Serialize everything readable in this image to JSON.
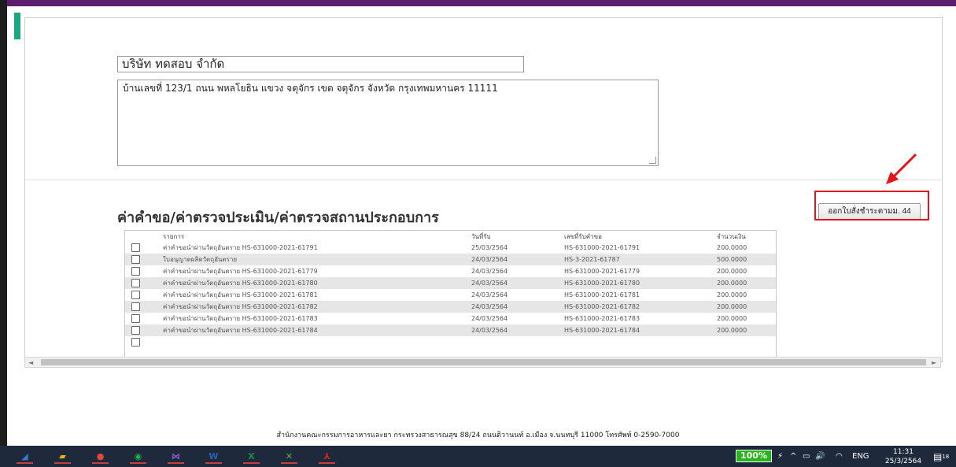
{
  "form": {
    "company_name": "บริษัท ทดสอบ จำกัด",
    "address": "บ้านเลขที่ 123/1 ถนน พหลโยธิน แขวง จตุจักร เขต จตุจักร จังหวัด กรุงเทพมหานคร 11111"
  },
  "section": {
    "title": "ค่าคำขอ/ค่าตรวจประเมิน/ค่าตรวจสถานประกอบการ",
    "issue_button_label": "ออกใบสั่งชำระตามม. 44"
  },
  "table": {
    "columns": [
      "รายการ",
      "วันที่รับ",
      "เลขที่รับคำขอ",
      "จำนวนเงิน"
    ],
    "rows": [
      {
        "item": "ค่าคำขอนำผ่านวัตถุอันตราย",
        "ref": "HS-631000-2021-61791",
        "date": "25/03/2564",
        "request_no": "HS-631000-2021-61791",
        "amount": "200.0000"
      },
      {
        "item": "ใบอนุญาตผลิตวัตถุอันตราย",
        "ref": "",
        "date": "24/03/2564",
        "request_no": "HS-3-2021-61787",
        "amount": "500.0000"
      },
      {
        "item": "ค่าคำขอนำผ่านวัตถุอันตราย",
        "ref": "HS-631000-2021-61779",
        "date": "24/03/2564",
        "request_no": "HS-631000-2021-61779",
        "amount": "200.0000"
      },
      {
        "item": "ค่าคำขอนำผ่านวัตถุอันตราย",
        "ref": "HS-631000-2021-61780",
        "date": "24/03/2564",
        "request_no": "HS-631000-2021-61780",
        "amount": "200.0000"
      },
      {
        "item": "ค่าคำขอนำผ่านวัตถุอันตราย",
        "ref": "HS-631000-2021-61781",
        "date": "24/03/2564",
        "request_no": "HS-631000-2021-61781",
        "amount": "200.0000"
      },
      {
        "item": "ค่าคำขอนำผ่านวัตถุอันตราย",
        "ref": "HS-631000-2021-61782",
        "date": "24/03/2564",
        "request_no": "HS-631000-2021-61782",
        "amount": "200.0000"
      },
      {
        "item": "ค่าคำขอนำผ่านวัตถุอันตราย",
        "ref": "HS-631000-2021-61783",
        "date": "24/03/2564",
        "request_no": "HS-631000-2021-61783",
        "amount": "200.0000"
      },
      {
        "item": "ค่าคำขอนำผ่านวัตถุอันตราย",
        "ref": "HS-631000-2021-61784",
        "date": "24/03/2564",
        "request_no": "HS-631000-2021-61784",
        "amount": "200.0000"
      }
    ]
  },
  "footer": {
    "text": "สำนักงานคณะกรรมการอาหารและยา กระทรวงสาธารณสุข 88/24 ถนนติวานนท์ อ.เมือง จ.นนทบุรี 11000 โทรศัพท์ 0-2590-7000"
  },
  "taskbar": {
    "battery": "100%",
    "language": "ENG",
    "time": "11:31",
    "date": "25/3/2564",
    "notifications": "18",
    "apps": [
      {
        "name": "settings-app-icon",
        "color": "#3a78c9",
        "glyph": "◢"
      },
      {
        "name": "sticky-notes-app-icon",
        "color": "#e8b400",
        "glyph": "▰"
      },
      {
        "name": "chrome-app-icon",
        "color": "#e8453c",
        "glyph": "●"
      },
      {
        "name": "line-app-icon",
        "color": "#22b24c",
        "glyph": "◉"
      },
      {
        "name": "visual-studio-app-icon",
        "color": "#9b59d0",
        "glyph": "⋈"
      },
      {
        "name": "word-app-icon",
        "color": "#2b5fb4",
        "glyph": "W"
      },
      {
        "name": "excel-app-icon",
        "color": "#1f8a4c",
        "glyph": "X"
      },
      {
        "name": "tools-app-icon",
        "color": "#6aa84f",
        "glyph": "✕"
      },
      {
        "name": "acrobat-app-icon",
        "color": "#d9231d",
        "glyph": "⅄"
      }
    ]
  },
  "colors": {
    "highlight": "#e3141b",
    "top_bar": "#5b1f6e",
    "battery": "#27b51b"
  }
}
